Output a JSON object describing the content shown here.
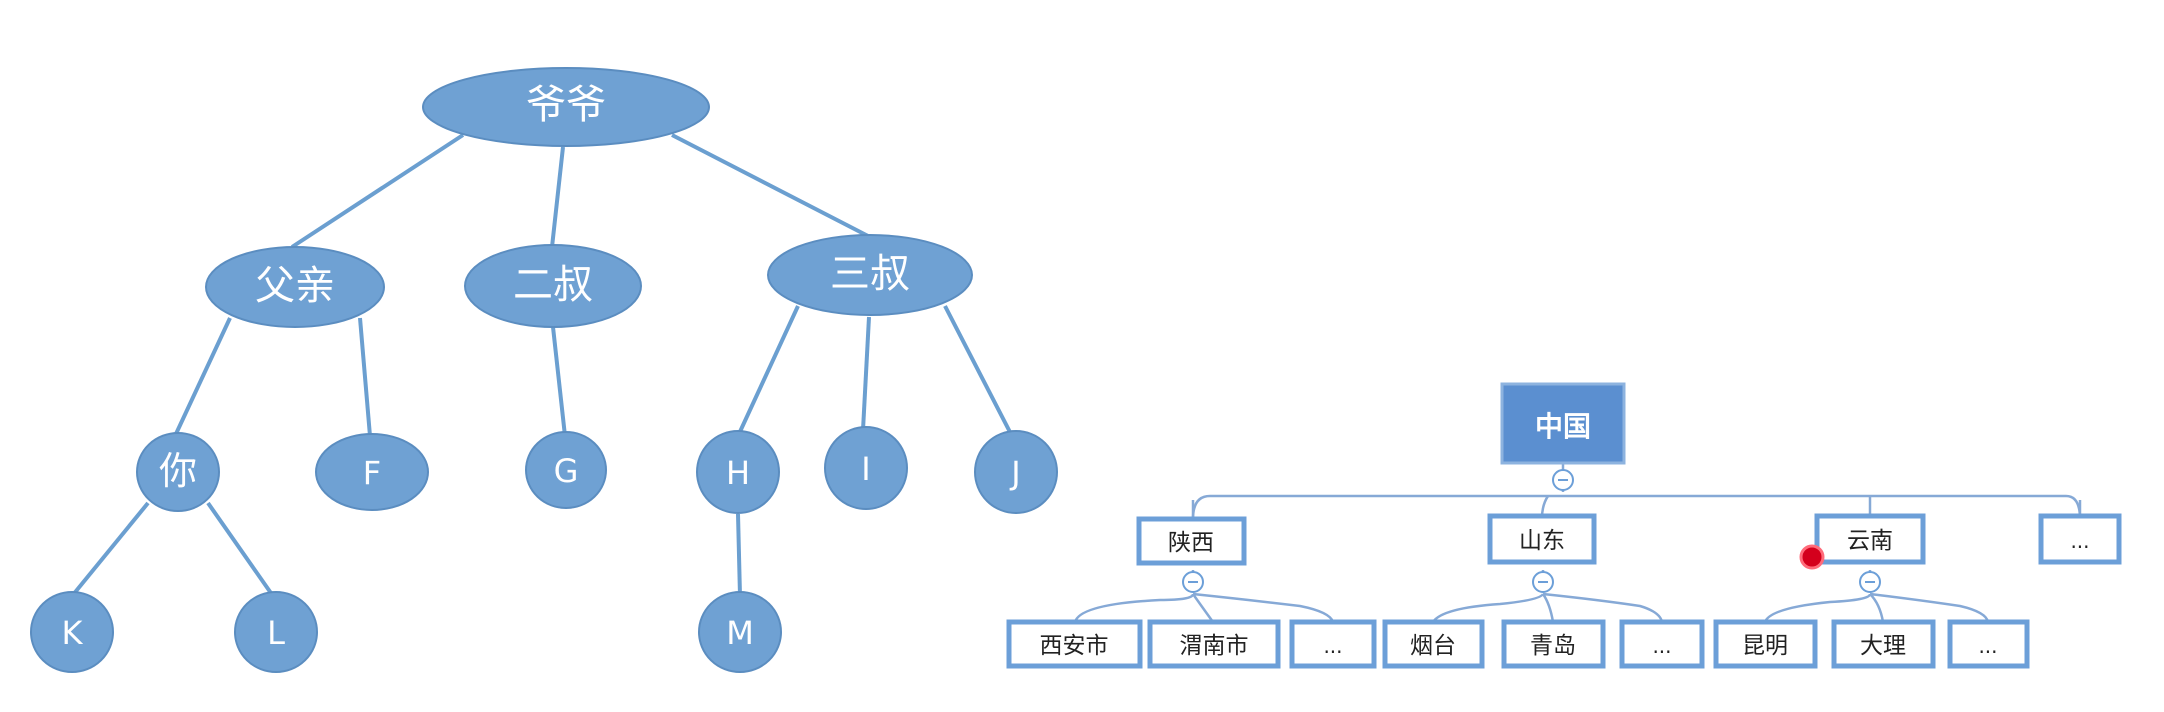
{
  "family_tree": {
    "root": "爷爷",
    "level1": [
      "父亲",
      "二叔",
      "三叔"
    ],
    "level2": [
      "你",
      "F",
      "G",
      "H",
      "I",
      "J"
    ],
    "level3": [
      "K",
      "L",
      "M"
    ]
  },
  "org_chart": {
    "root": "中国",
    "provinces": [
      {
        "name": "陕西",
        "cities": [
          "西安市",
          "渭南市",
          "..."
        ]
      },
      {
        "name": "山东",
        "cities": [
          "烟台",
          "青岛",
          "..."
        ]
      },
      {
        "name": "云南",
        "cities": [
          "昆明",
          "大理",
          "..."
        ]
      },
      {
        "name": "...",
        "cities": []
      }
    ]
  },
  "colors": {
    "node_fill": "#6fa1d3",
    "edge": "#6b9fd0",
    "org_root_fill": "#5b8fd0",
    "org_box_stroke": "#6c9fd8",
    "cursor": "#d4001c"
  }
}
